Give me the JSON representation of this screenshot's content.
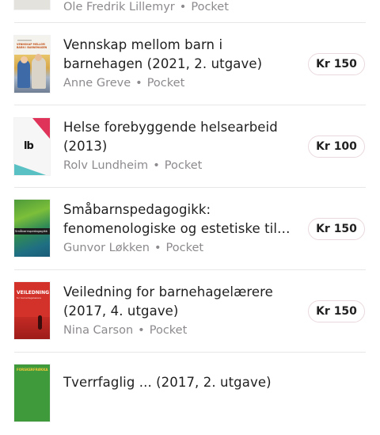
{
  "books": [
    {
      "title": "",
      "author": "Ole Fredrik Lillemyr",
      "format": "Pocket",
      "price": ""
    },
    {
      "title_line1": "Vennskap mellom barn i",
      "title_line2": "barnehagen (2021, 2. utgave)",
      "author": "Anne Greve",
      "format": "Pocket",
      "price": "Kr 150",
      "cover_text": "VENNSKAP MELLOM BARN I BARNEHAGEN"
    },
    {
      "title_line1": "Helse forebyggende helsearbeid",
      "title_line2": "(2013)",
      "author": "Rolv Lundheim",
      "format": "Pocket",
      "price": "Kr 100",
      "cover_logo": "lb"
    },
    {
      "title_line1": "Småbarnspedagogikk:",
      "title_line2": "fenomenologiske og estetiske til…",
      "author": "Gunvor Løkken",
      "format": "Pocket",
      "price": "Kr 150",
      "cover_text": "Småbarnspedagogikk"
    },
    {
      "title_line1": "Veiledning for barnehagelærere",
      "title_line2": "(2017, 4. utgave)",
      "author": "Nina Carson",
      "format": "Pocket",
      "price": "Kr 150",
      "cover_text": "VEILEDNING",
      "cover_subtext": "for barnehagelærere"
    },
    {
      "title_line1": "Tverrfaglig ... (2017, 2. utgave)",
      "cover_text": "FORSKERFRØKKA"
    }
  ],
  "dot": "•",
  "colors": {
    "price_border": "#ead9dc",
    "meta": "#8d8a8e",
    "divider": "#e9e6ea"
  }
}
